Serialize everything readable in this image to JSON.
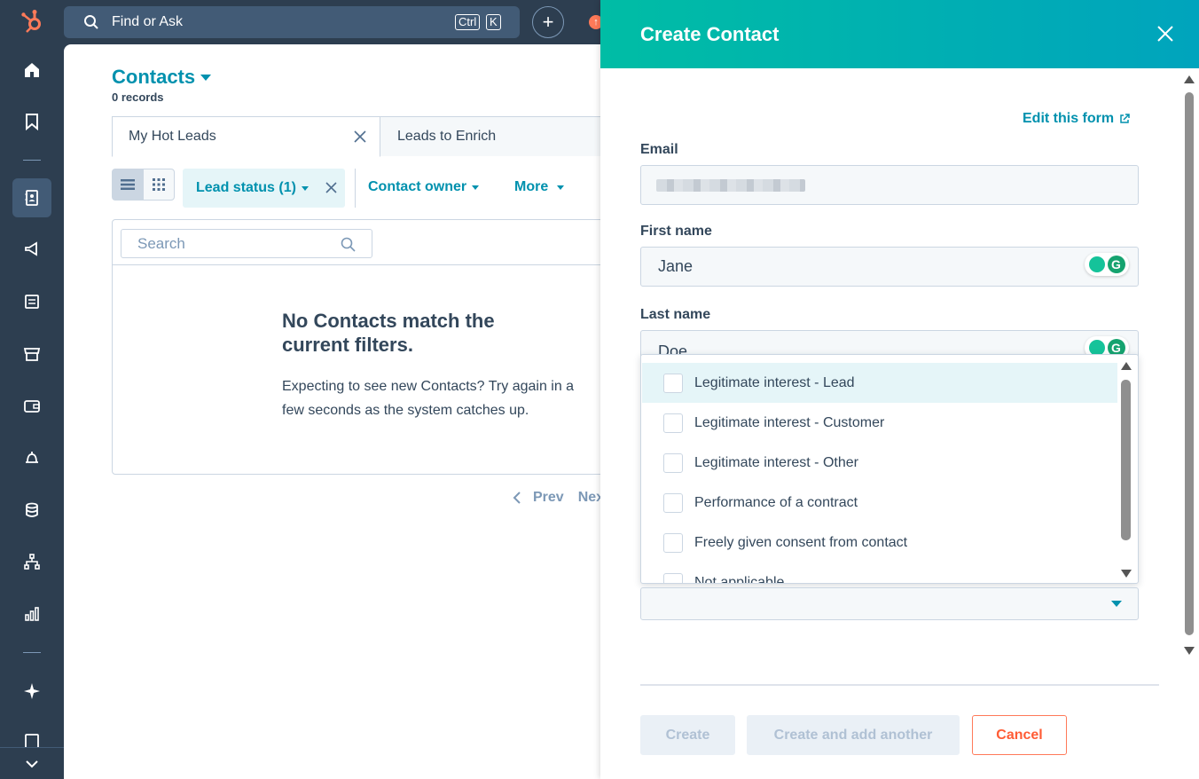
{
  "topbar": {
    "search_placeholder": "Find or Ask",
    "shortcut_ctrl": "Ctrl",
    "shortcut_key": "K",
    "add_label": "+",
    "upgrade_label": "↑"
  },
  "contacts": {
    "title": "Contacts",
    "record_count": "0 records",
    "tabs": [
      {
        "label": "My Hot Leads"
      },
      {
        "label": "Leads to Enrich"
      }
    ],
    "filters": {
      "lead_status": "Lead status (1)",
      "contact_owner": "Contact owner",
      "more": "More"
    },
    "table_search_placeholder": "Search",
    "empty_title": "No Contacts match the current filters.",
    "empty_body": "Expecting to see new Contacts? Try again in a few seconds as the system catches up.",
    "pager_prev": "Prev",
    "pager_next": "Next"
  },
  "panel": {
    "title": "Create Contact",
    "edit_form_link": "Edit this form",
    "fields": {
      "email_label": "Email",
      "first_name_label": "First name",
      "first_name_value": "Jane",
      "last_name_label": "Last name",
      "last_name_value": "Doe"
    },
    "legal_basis_options": [
      "Legitimate interest - Lead",
      "Legitimate interest - Customer",
      "Legitimate interest - Other",
      "Performance of a contract",
      "Freely given consent from contact",
      "Not applicable"
    ],
    "buttons": {
      "create": "Create",
      "create_another": "Create and add another",
      "cancel": "Cancel"
    }
  },
  "colors": {
    "nav_bg": "#2d3e50",
    "accent": "#0091ae",
    "header_gradient_start": "#00bda5",
    "header_gradient_end": "#00a4bd",
    "cancel": "#ff5c35"
  }
}
